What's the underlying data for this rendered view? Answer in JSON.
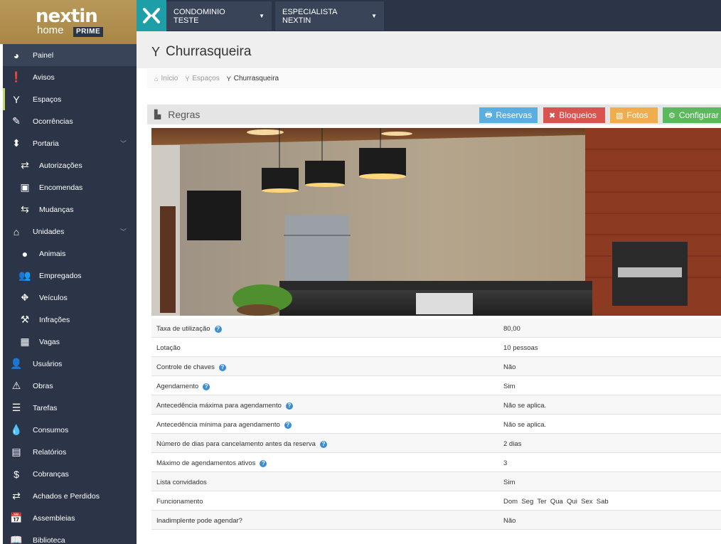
{
  "brand": {
    "logo_main": "nextin",
    "logo_sub": "home",
    "logo_badge": "PRIME"
  },
  "topbar": {
    "condo_label": "CONDOMINIO TESTE",
    "user_label": "ESPECIALISTA NEXTIN"
  },
  "sidebar": {
    "items": [
      {
        "label": "Painel",
        "icon": "dashboard-icon"
      },
      {
        "label": "Avisos",
        "icon": "exclamation-icon"
      },
      {
        "label": "Espaços",
        "icon": "glass-icon"
      },
      {
        "label": "Ocorrências",
        "icon": "edit-icon"
      },
      {
        "label": "Portaria",
        "icon": "sort-icon"
      },
      {
        "label": "Autorizações",
        "icon": "exchange-icon"
      },
      {
        "label": "Encomendas",
        "icon": "gift-icon"
      },
      {
        "label": "Mudanças",
        "icon": "arrows-icon"
      },
      {
        "label": "Unidades",
        "icon": "home-icon"
      },
      {
        "label": "Animais",
        "icon": "github-icon"
      },
      {
        "label": "Empregados",
        "icon": "users-icon"
      },
      {
        "label": "Veículos",
        "icon": "road-icon"
      },
      {
        "label": "Infrações",
        "icon": "gavel-icon"
      },
      {
        "label": "Vagas",
        "icon": "th-large-icon"
      },
      {
        "label": "Usuários",
        "icon": "user-icon"
      },
      {
        "label": "Obras",
        "icon": "warning-icon"
      },
      {
        "label": "Tarefas",
        "icon": "list-icon"
      },
      {
        "label": "Consumos",
        "icon": "tint-icon"
      },
      {
        "label": "Relatórios",
        "icon": "report-icon"
      },
      {
        "label": "Cobranças",
        "icon": "dollar-icon"
      },
      {
        "label": "Achados e Perdidos",
        "icon": "exchange-icon"
      },
      {
        "label": "Assembleias",
        "icon": "calendar-icon"
      },
      {
        "label": "Biblioteca",
        "icon": "book-icon"
      }
    ]
  },
  "page": {
    "title": "Churrasqueira",
    "breadcrumb": [
      "Início",
      "Espaços",
      "Churrasqueira"
    ]
  },
  "section": {
    "title": "Regras",
    "buttons": {
      "reservas": "Reservas",
      "bloqueios": "Bloqueios",
      "fotos": "Fotos",
      "configurar": "Configurar"
    }
  },
  "rules": [
    {
      "label": "Taxa de utilização",
      "help": true,
      "value": "80,00"
    },
    {
      "label": "Lotação",
      "help": false,
      "value": "10 pessoas"
    },
    {
      "label": "Controle de chaves",
      "help": true,
      "value": "Não"
    },
    {
      "label": "Agendamento",
      "help": true,
      "value": "Sim"
    },
    {
      "label": "Antecedência máxima para agendamento",
      "help": true,
      "value": "Não se aplica."
    },
    {
      "label": "Antecedência mínima para agendamento",
      "help": true,
      "value": "Não se aplica."
    },
    {
      "label": "Número de dias para cancelamento antes da reserva",
      "help": true,
      "value": "2 dias"
    },
    {
      "label": "Máximo de agendamentos ativos",
      "help": true,
      "value": "3"
    },
    {
      "label": "Lista convidados",
      "help": false,
      "value": "Sim"
    },
    {
      "label": "Funcionamento",
      "help": false,
      "value": "Dom  Seg  Ter  Qua  Qui  Sex  Sab"
    },
    {
      "label": "Inadimplente pode agendar?",
      "help": false,
      "value": "Não"
    }
  ],
  "colors": {
    "sidebar": "#2c3548",
    "accent_teal": "#1e9fa8",
    "btn_reservas": "#5aaee0",
    "btn_bloqueios": "#d9534f",
    "btn_fotos": "#f0ad4e",
    "btn_configurar": "#5cb85c"
  }
}
